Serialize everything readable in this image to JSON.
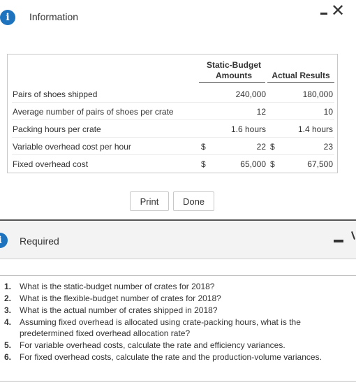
{
  "dialog": {
    "icon": "info-icon",
    "title": "Information",
    "icon_glyph": "i"
  },
  "table": {
    "headers": {
      "static_budget_line1": "Static-Budget",
      "static_budget_line2": "Amounts",
      "actual_results": "Actual Results"
    },
    "rows": [
      {
        "label": "Pairs of shoes shipped",
        "dollar_static": "",
        "static": "240,000",
        "dollar_actual": "",
        "actual": "180,000"
      },
      {
        "label": "Average number of pairs of shoes per crate",
        "dollar_static": "",
        "static": "12",
        "dollar_actual": "",
        "actual": "10"
      },
      {
        "label": "Packing hours per crate",
        "dollar_static": "",
        "static": "1.6 hours",
        "dollar_actual": "",
        "actual": "1.4 hours"
      },
      {
        "label": "Variable overhead cost per hour",
        "dollar_static": "$",
        "static": "22",
        "dollar_actual": "$",
        "actual": "23"
      },
      {
        "label": "Fixed overhead cost",
        "dollar_static": "$",
        "static": "65,000",
        "dollar_actual": "$",
        "actual": "67,500"
      }
    ]
  },
  "buttons": {
    "print": "Print",
    "done": "Done"
  },
  "required": {
    "title": "Required",
    "icon_glyph": "i",
    "questions": [
      {
        "num": "1.",
        "text": "What is the static-budget number of crates for 2018?"
      },
      {
        "num": "2.",
        "text": "What is the flexible-budget number of crates for 2018?"
      },
      {
        "num": "3.",
        "text": "What is the actual number of crates shipped in 2018?"
      },
      {
        "num": "4.",
        "text": "Assuming fixed overhead is allocated using crate-packing hours, what is the predetermined fixed overhead allocation rate?"
      },
      {
        "num": "5.",
        "text": "For variable overhead costs, calculate the rate and efficiency variances."
      },
      {
        "num": "6.",
        "text": "For fixed overhead costs, calculate the rate and the production-volume variances."
      }
    ]
  },
  "colors": {
    "info_icon": "#1e73be",
    "text": "#333333",
    "border": "#c8c8c8"
  }
}
